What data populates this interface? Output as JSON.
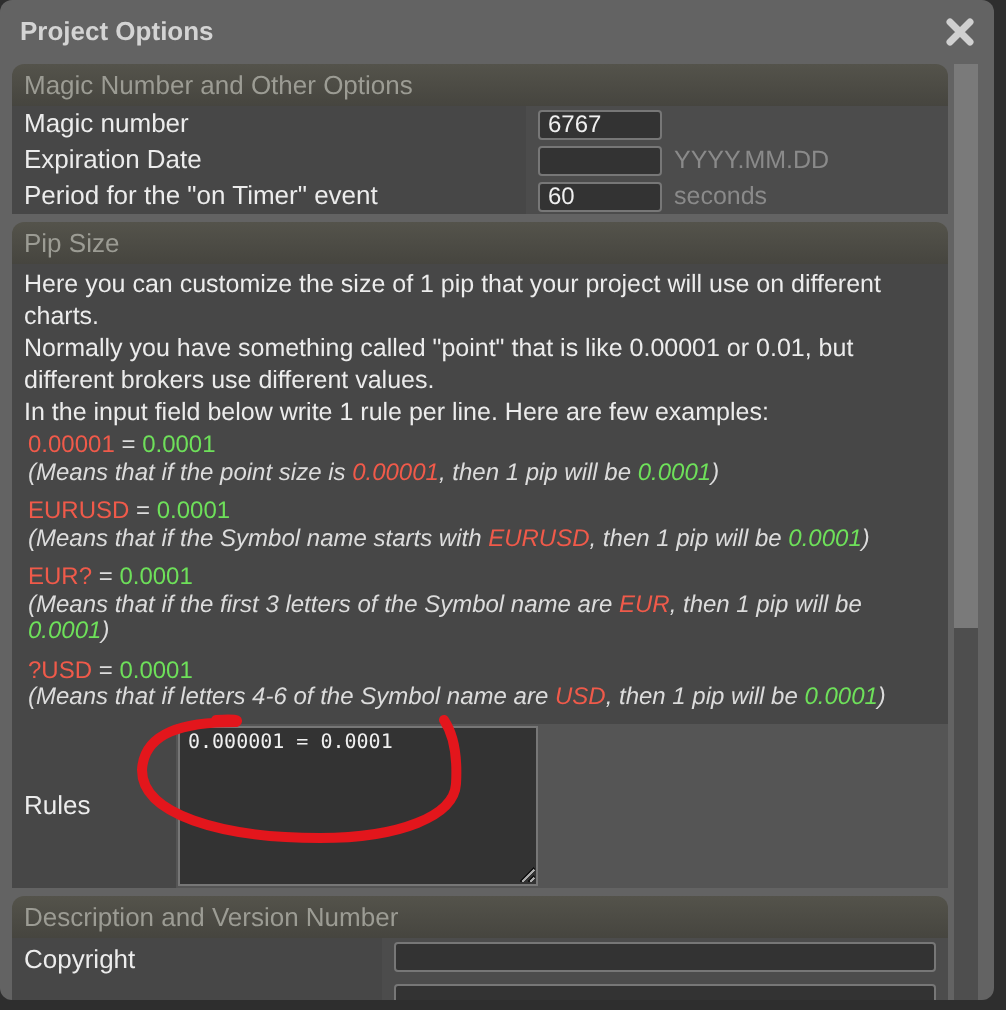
{
  "window": {
    "title": "Project Options"
  },
  "sections": [
    {
      "kind": "fields",
      "title": "Magic Number and Other Options",
      "rows": [
        {
          "kind": "short",
          "label": "Magic number",
          "value": "6767"
        },
        {
          "kind": "short",
          "label": "Expiration Date",
          "unit": "YYYY.MM.DD"
        },
        {
          "kind": "short",
          "label": "Period for the \"on Timer\" event",
          "value": "60",
          "unit": "seconds"
        }
      ]
    },
    {
      "kind": "pip",
      "title": "Pip Size",
      "intro": [
        "Here you can customize the size of 1 pip that your project will use on different charts.",
        "Normally you have something called \"point\" that is like 0.00001 or 0.01, but different brokers use different values.",
        "In the input field below write 1 rule per line. Here are few examples:"
      ],
      "examples": [
        {
          "rule": [
            {
              "text": "0.00001",
              "color": "#f05a4a"
            },
            {
              "text": " = "
            },
            {
              "text": "0.0001",
              "color": "#6ee05a"
            }
          ],
          "meaning": [
            {
              "text": "(Means that if the point size is "
            },
            {
              "text": "0.00001",
              "color": "#f05a4a"
            },
            {
              "text": ", then 1 pip will be "
            },
            {
              "text": "0.0001",
              "color": "#6ee05a"
            },
            {
              "text": ")"
            }
          ]
        },
        {
          "rule": [
            {
              "text": "EURUSD",
              "color": "#f05a4a"
            },
            {
              "text": " = "
            },
            {
              "text": "0.0001",
              "color": "#6ee05a"
            }
          ],
          "meaning": [
            {
              "text": "(Means that if the Symbol name starts with "
            },
            {
              "text": "EURUSD",
              "color": "#f05a4a"
            },
            {
              "text": ", then 1 pip will be "
            },
            {
              "text": "0.0001",
              "color": "#6ee05a"
            },
            {
              "text": ")"
            }
          ]
        },
        {
          "rule": [
            {
              "text": "EUR?",
              "color": "#f05a4a"
            },
            {
              "text": " = "
            },
            {
              "text": "0.0001",
              "color": "#6ee05a"
            }
          ],
          "meaning": [
            {
              "text": "(Means that if the first 3 letters of the Symbol name are "
            },
            {
              "text": "EUR",
              "color": "#f05a4a"
            },
            {
              "text": ", then 1 pip will be "
            },
            {
              "text": "0.0001",
              "color": "#6ee05a"
            },
            {
              "text": ")"
            }
          ]
        },
        {
          "rule": [
            {
              "text": "?USD",
              "color": "#f05a4a"
            },
            {
              "text": " = "
            },
            {
              "text": "0.0001",
              "color": "#6ee05a"
            }
          ],
          "meaning": [
            {
              "text": "(Means that if letters 4-6 of the Symbol name are "
            },
            {
              "text": "USD",
              "color": "#f05a4a"
            },
            {
              "text": ", then 1 pip will be "
            },
            {
              "text": "0.0001",
              "color": "#6ee05a"
            },
            {
              "text": ")"
            }
          ]
        }
      ],
      "rules": {
        "label": "Rules",
        "value": "0.000001 = 0.0001"
      }
    },
    {
      "kind": "fields",
      "title": "Description and Version Number",
      "rows": [
        {
          "kind": "wide",
          "label": "Copyright"
        }
      ]
    }
  ]
}
